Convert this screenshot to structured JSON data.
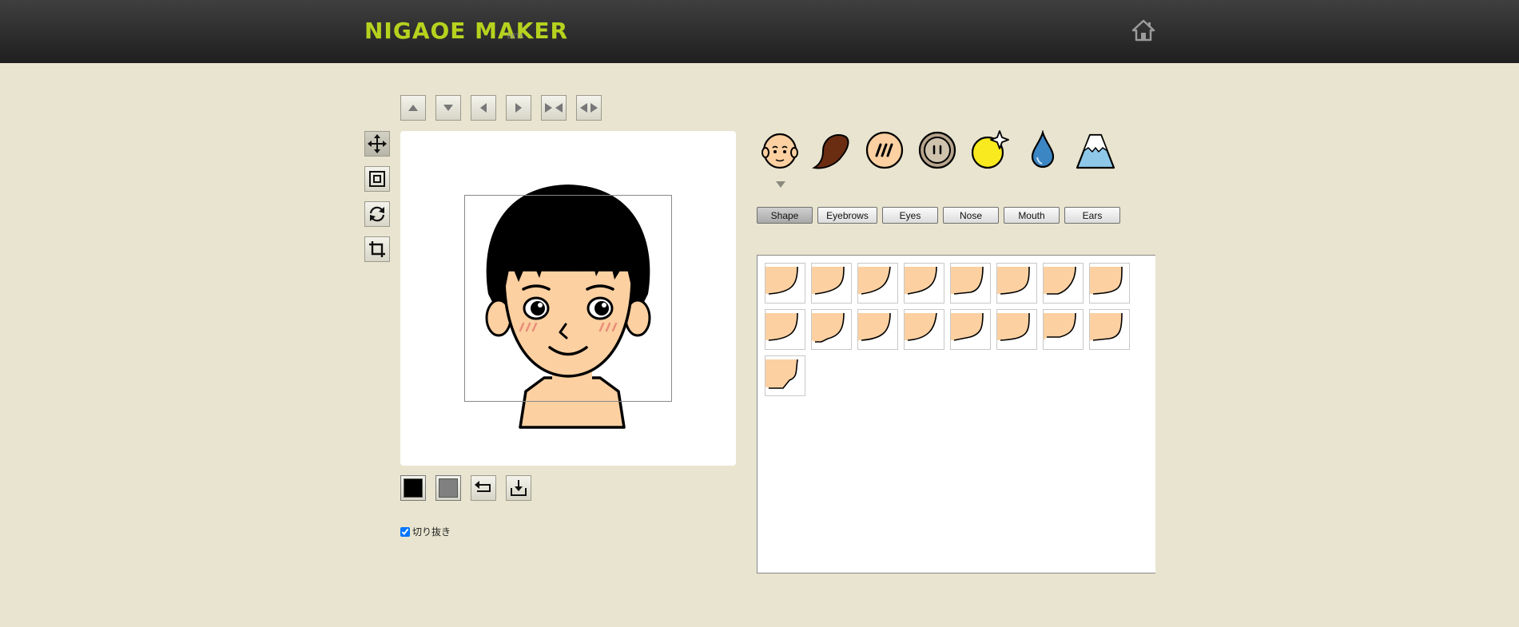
{
  "header": {
    "logo_text": "NIGAOE MAKER",
    "logo_badge": "BETA",
    "accent_color": "#b7d21e"
  },
  "toolbar": {
    "top_buttons": [
      "move-up-icon",
      "move-down-icon",
      "move-left-icon",
      "move-right-icon",
      "narrow-icon",
      "widen-icon"
    ],
    "side_buttons": [
      "move-tool-icon",
      "scale-tool-icon",
      "rotate-tool-icon",
      "crop-tool-icon"
    ]
  },
  "colors": {
    "primary": "#000000",
    "secondary": "#808080",
    "skin": "#fcd0a1"
  },
  "options": {
    "clip_label": "切り抜き",
    "clip_checked": true
  },
  "categories": [
    "face-icon",
    "hair-icon",
    "cheek-icon",
    "button-icon",
    "sparkle-icon",
    "drop-icon",
    "mountain-icon"
  ],
  "tabs": [
    "Shape",
    "Eyebrows",
    "Eyes",
    "Nose",
    "Mouth",
    "Ears"
  ],
  "active_tab": "Shape",
  "thumbnails_count": 17
}
